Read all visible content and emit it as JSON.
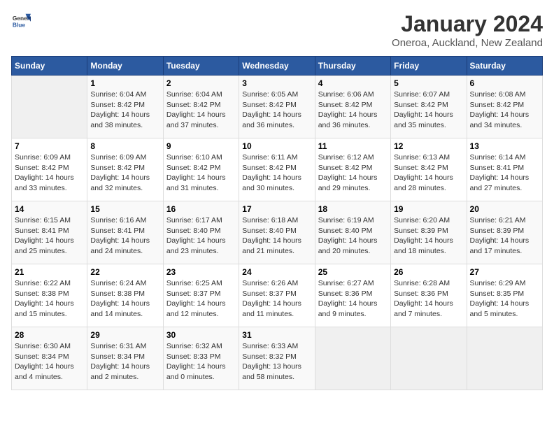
{
  "header": {
    "logo_general": "General",
    "logo_blue": "Blue",
    "title": "January 2024",
    "subtitle": "Oneroa, Auckland, New Zealand"
  },
  "days_of_week": [
    "Sunday",
    "Monday",
    "Tuesday",
    "Wednesday",
    "Thursday",
    "Friday",
    "Saturday"
  ],
  "weeks": [
    [
      {
        "day": "",
        "info": ""
      },
      {
        "day": "1",
        "info": "Sunrise: 6:04 AM\nSunset: 8:42 PM\nDaylight: 14 hours\nand 38 minutes."
      },
      {
        "day": "2",
        "info": "Sunrise: 6:04 AM\nSunset: 8:42 PM\nDaylight: 14 hours\nand 37 minutes."
      },
      {
        "day": "3",
        "info": "Sunrise: 6:05 AM\nSunset: 8:42 PM\nDaylight: 14 hours\nand 36 minutes."
      },
      {
        "day": "4",
        "info": "Sunrise: 6:06 AM\nSunset: 8:42 PM\nDaylight: 14 hours\nand 36 minutes."
      },
      {
        "day": "5",
        "info": "Sunrise: 6:07 AM\nSunset: 8:42 PM\nDaylight: 14 hours\nand 35 minutes."
      },
      {
        "day": "6",
        "info": "Sunrise: 6:08 AM\nSunset: 8:42 PM\nDaylight: 14 hours\nand 34 minutes."
      }
    ],
    [
      {
        "day": "7",
        "info": "Sunrise: 6:09 AM\nSunset: 8:42 PM\nDaylight: 14 hours\nand 33 minutes."
      },
      {
        "day": "8",
        "info": "Sunrise: 6:09 AM\nSunset: 8:42 PM\nDaylight: 14 hours\nand 32 minutes."
      },
      {
        "day": "9",
        "info": "Sunrise: 6:10 AM\nSunset: 8:42 PM\nDaylight: 14 hours\nand 31 minutes."
      },
      {
        "day": "10",
        "info": "Sunrise: 6:11 AM\nSunset: 8:42 PM\nDaylight: 14 hours\nand 30 minutes."
      },
      {
        "day": "11",
        "info": "Sunrise: 6:12 AM\nSunset: 8:42 PM\nDaylight: 14 hours\nand 29 minutes."
      },
      {
        "day": "12",
        "info": "Sunrise: 6:13 AM\nSunset: 8:42 PM\nDaylight: 14 hours\nand 28 minutes."
      },
      {
        "day": "13",
        "info": "Sunrise: 6:14 AM\nSunset: 8:41 PM\nDaylight: 14 hours\nand 27 minutes."
      }
    ],
    [
      {
        "day": "14",
        "info": "Sunrise: 6:15 AM\nSunset: 8:41 PM\nDaylight: 14 hours\nand 25 minutes."
      },
      {
        "day": "15",
        "info": "Sunrise: 6:16 AM\nSunset: 8:41 PM\nDaylight: 14 hours\nand 24 minutes."
      },
      {
        "day": "16",
        "info": "Sunrise: 6:17 AM\nSunset: 8:40 PM\nDaylight: 14 hours\nand 23 minutes."
      },
      {
        "day": "17",
        "info": "Sunrise: 6:18 AM\nSunset: 8:40 PM\nDaylight: 14 hours\nand 21 minutes."
      },
      {
        "day": "18",
        "info": "Sunrise: 6:19 AM\nSunset: 8:40 PM\nDaylight: 14 hours\nand 20 minutes."
      },
      {
        "day": "19",
        "info": "Sunrise: 6:20 AM\nSunset: 8:39 PM\nDaylight: 14 hours\nand 18 minutes."
      },
      {
        "day": "20",
        "info": "Sunrise: 6:21 AM\nSunset: 8:39 PM\nDaylight: 14 hours\nand 17 minutes."
      }
    ],
    [
      {
        "day": "21",
        "info": "Sunrise: 6:22 AM\nSunset: 8:38 PM\nDaylight: 14 hours\nand 15 minutes."
      },
      {
        "day": "22",
        "info": "Sunrise: 6:24 AM\nSunset: 8:38 PM\nDaylight: 14 hours\nand 14 minutes."
      },
      {
        "day": "23",
        "info": "Sunrise: 6:25 AM\nSunset: 8:37 PM\nDaylight: 14 hours\nand 12 minutes."
      },
      {
        "day": "24",
        "info": "Sunrise: 6:26 AM\nSunset: 8:37 PM\nDaylight: 14 hours\nand 11 minutes."
      },
      {
        "day": "25",
        "info": "Sunrise: 6:27 AM\nSunset: 8:36 PM\nDaylight: 14 hours\nand 9 minutes."
      },
      {
        "day": "26",
        "info": "Sunrise: 6:28 AM\nSunset: 8:36 PM\nDaylight: 14 hours\nand 7 minutes."
      },
      {
        "day": "27",
        "info": "Sunrise: 6:29 AM\nSunset: 8:35 PM\nDaylight: 14 hours\nand 5 minutes."
      }
    ],
    [
      {
        "day": "28",
        "info": "Sunrise: 6:30 AM\nSunset: 8:34 PM\nDaylight: 14 hours\nand 4 minutes."
      },
      {
        "day": "29",
        "info": "Sunrise: 6:31 AM\nSunset: 8:34 PM\nDaylight: 14 hours\nand 2 minutes."
      },
      {
        "day": "30",
        "info": "Sunrise: 6:32 AM\nSunset: 8:33 PM\nDaylight: 14 hours\nand 0 minutes."
      },
      {
        "day": "31",
        "info": "Sunrise: 6:33 AM\nSunset: 8:32 PM\nDaylight: 13 hours\nand 58 minutes."
      },
      {
        "day": "",
        "info": ""
      },
      {
        "day": "",
        "info": ""
      },
      {
        "day": "",
        "info": ""
      }
    ]
  ]
}
